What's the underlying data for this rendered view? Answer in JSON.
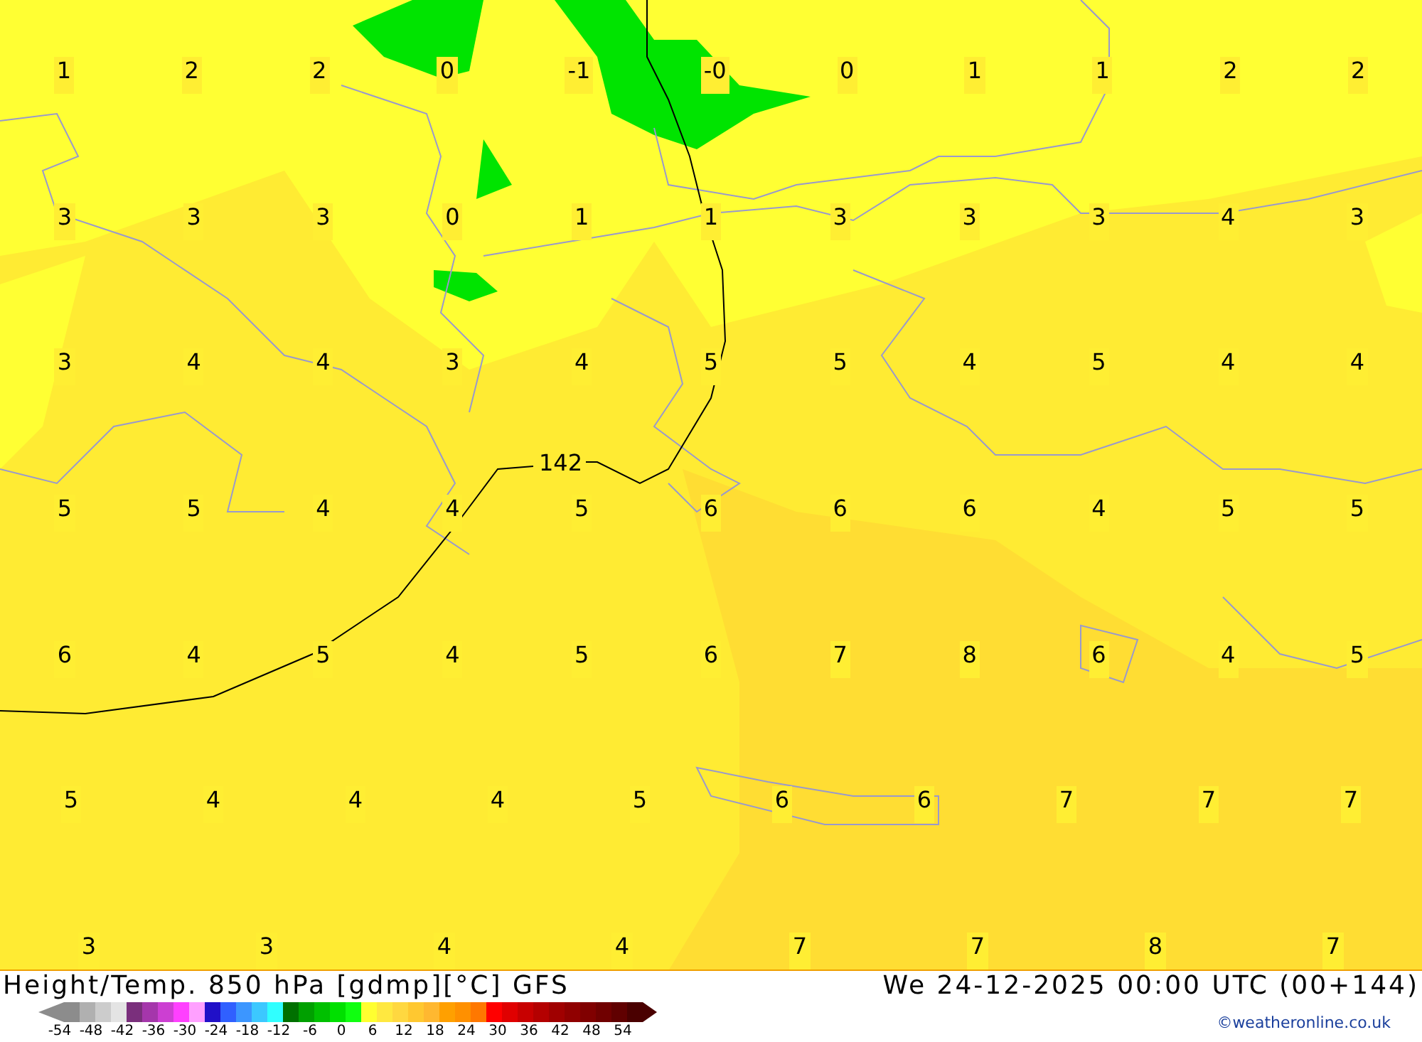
{
  "map": {
    "value_rows": [
      [
        "1",
        "2",
        "2",
        "0",
        "-1",
        "-0",
        "0",
        "1",
        "1",
        "2",
        "2"
      ],
      [
        "3",
        "3",
        "3",
        "0",
        "1",
        "1",
        "3",
        "3",
        "3",
        "4",
        "3"
      ],
      [
        "3",
        "4",
        "4",
        "3",
        "4",
        "5",
        "5",
        "4",
        "5",
        "4",
        "4"
      ],
      [
        "5",
        "5",
        "4",
        "4",
        "5",
        "6",
        "6",
        "6",
        "4",
        "5",
        "5"
      ],
      [
        "6",
        "4",
        "5",
        "4",
        "5",
        "6",
        "7",
        "8",
        "6",
        "4",
        "5"
      ],
      [
        "5",
        "4",
        "4",
        "4",
        "5",
        "6",
        "6",
        "7",
        "7",
        "7"
      ],
      [
        "3",
        "3",
        "4",
        "4",
        "7",
        "7",
        "8",
        "7"
      ]
    ],
    "contour_label": "142"
  },
  "footer": {
    "title": "Height/Temp. 850 hPa [gdmp][°C] GFS",
    "datetime": "We 24-12-2025 00:00 UTC (00+144)",
    "credit": "©weatheronline.co.uk"
  },
  "legend": {
    "swatches": [
      {
        "color": "#8c8c8c"
      },
      {
        "color": "#b0b0b0"
      },
      {
        "color": "#cccccc"
      },
      {
        "color": "#e4e4e4"
      },
      {
        "color": "#7a2f7c"
      },
      {
        "color": "#a536ab"
      },
      {
        "color": "#cc3fd2"
      },
      {
        "color": "#ff40ff"
      },
      {
        "color": "#ffa0ff"
      },
      {
        "color": "#2010c8"
      },
      {
        "color": "#3060ff"
      },
      {
        "color": "#3c96ff"
      },
      {
        "color": "#3cc8ff"
      },
      {
        "color": "#30ffff"
      },
      {
        "color": "#007000"
      },
      {
        "color": "#00a000"
      },
      {
        "color": "#00c000"
      },
      {
        "color": "#00e000"
      },
      {
        "color": "#10ff10"
      },
      {
        "color": "#ffff30"
      },
      {
        "color": "#ffe840"
      },
      {
        "color": "#ffd840"
      },
      {
        "color": "#ffc830"
      },
      {
        "color": "#ffb830"
      },
      {
        "color": "#ffa000"
      },
      {
        "color": "#ff9000"
      },
      {
        "color": "#ff7800"
      },
      {
        "color": "#ff0000"
      },
      {
        "color": "#e00000"
      },
      {
        "color": "#c80000"
      },
      {
        "color": "#b40000"
      },
      {
        "color": "#a00000"
      },
      {
        "color": "#900000"
      },
      {
        "color": "#800000"
      },
      {
        "color": "#700000"
      },
      {
        "color": "#600000"
      },
      {
        "color": "#4a0000"
      }
    ],
    "ticks": [
      "-54",
      "-48",
      "-42",
      "-36",
      "-30",
      "-24",
      "-18",
      "-12",
      "-6",
      "0",
      "6",
      "12",
      "18",
      "24",
      "30",
      "36",
      "42",
      "48",
      "54"
    ]
  }
}
